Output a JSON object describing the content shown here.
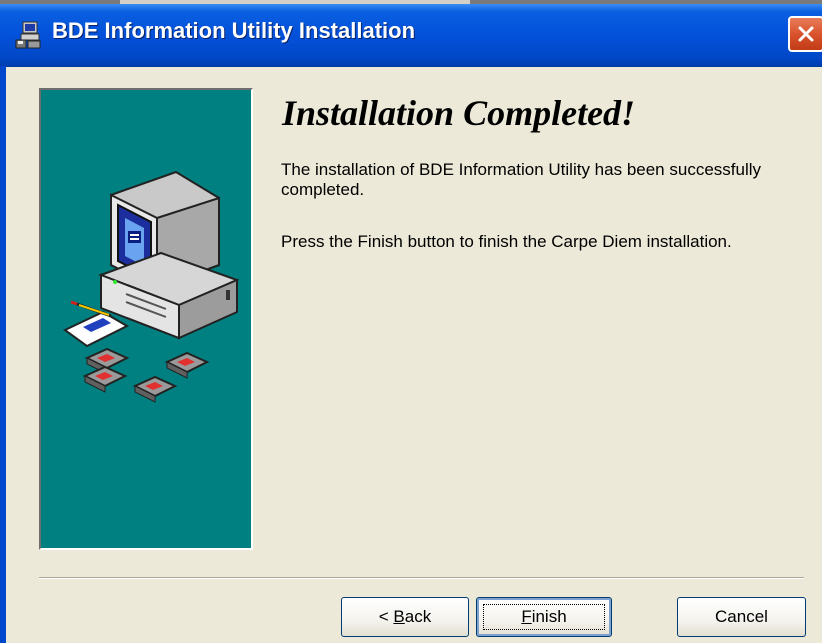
{
  "window": {
    "title": "BDE Information Utility Installation",
    "close_icon": "close-icon"
  },
  "content": {
    "heading": "Installation Completed!",
    "paragraph1": "The installation of BDE Information Utility has been successfully completed.",
    "paragraph2": "Press the Finish button to finish the Carpe Diem installation."
  },
  "buttons": {
    "back_prefix": "< ",
    "back_mnemonic": "B",
    "back_rest": "ack",
    "finish_mnemonic": "F",
    "finish_rest": "inish",
    "cancel": "Cancel"
  },
  "colors": {
    "titlebar": "#0351DA",
    "panel": "#008080",
    "dialog_bg": "#ECE9D8"
  },
  "icons": {
    "title": "setup-computer-icon",
    "panel_art": "computer-with-disks-illustration"
  }
}
